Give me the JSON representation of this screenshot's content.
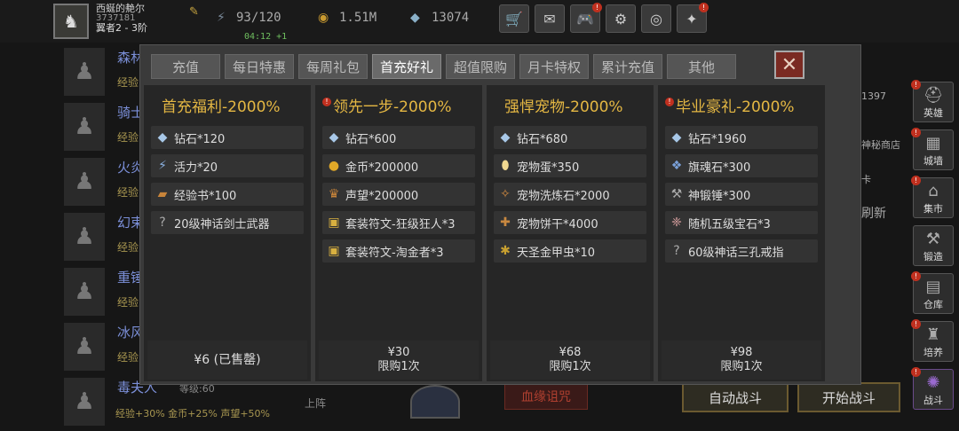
{
  "header": {
    "player_name": "西蜒的艴尔",
    "player_id": "3737181",
    "player_rank": "翼者2 - 3阶",
    "energy": "93/120",
    "timer": "04:12 +1",
    "gold": "1.51M",
    "diamonds": "13074"
  },
  "background": {
    "heroes": [
      {
        "name": "森林",
        "exp": "经验"
      },
      {
        "name": "骑士",
        "exp": "经验"
      },
      {
        "name": "火炎",
        "exp": "经验"
      },
      {
        "name": "幻束",
        "exp": "经验"
      },
      {
        "name": "重锤",
        "exp": "经验"
      },
      {
        "name": "冰风",
        "exp": "经验"
      },
      {
        "name": "毒夫人",
        "exp": "经验",
        "level": "等级:60"
      }
    ],
    "bottom_stats": "经验+30%  金币+25%  声望+50%",
    "up_label": "上阵",
    "curse_label": "血缘诅咒",
    "auto_battle": "自动战斗",
    "start_battle": "开始战斗",
    "right_number": "1397",
    "right_shop": "神秘商店",
    "right_refresh": "刷新",
    "right_card": "卡"
  },
  "sidebar": [
    {
      "label": "英雄",
      "icon": "helmet-icon",
      "alert": true
    },
    {
      "label": "城墙",
      "icon": "wall-icon",
      "alert": true
    },
    {
      "label": "集市",
      "icon": "market-icon",
      "alert": true
    },
    {
      "label": "锻造",
      "icon": "anvil-icon",
      "alert": false
    },
    {
      "label": "仓库",
      "icon": "warehouse-icon",
      "alert": true
    },
    {
      "label": "培养",
      "icon": "train-icon",
      "alert": true
    },
    {
      "label": "战斗",
      "icon": "battle-portal-icon",
      "alert": true
    }
  ],
  "tabs": [
    "充值",
    "每日特惠",
    "每周礼包",
    "首充好礼",
    "超值限购",
    "月卡特权",
    "累计充值",
    "其他"
  ],
  "active_tab": 3,
  "packs": [
    {
      "title": "首充福利-2000%",
      "alert": false,
      "items": [
        {
          "icon": "diamond-icon",
          "text": "钻石*120"
        },
        {
          "icon": "energy-icon",
          "text": "活力*20"
        },
        {
          "icon": "exp-book-icon",
          "text": "经验书*100"
        },
        {
          "icon": "weapon-icon",
          "text": "20级神话剑士武器"
        }
      ],
      "price": "¥6 (已售罄)",
      "limit": ""
    },
    {
      "title": "领先一步-2000%",
      "alert": true,
      "items": [
        {
          "icon": "diamond-icon",
          "text": "钻石*600"
        },
        {
          "icon": "gold-coin-icon",
          "text": "金币*200000"
        },
        {
          "icon": "prestige-icon",
          "text": "声望*200000"
        },
        {
          "icon": "rune-icon",
          "text": "套装符文-狂级狂人*3"
        },
        {
          "icon": "rune-icon",
          "text": "套装符文-淘金者*3"
        }
      ],
      "price": "¥30",
      "limit": "限购1次"
    },
    {
      "title": "强悍宠物-2000%",
      "alert": false,
      "items": [
        {
          "icon": "diamond-icon",
          "text": "钻石*680"
        },
        {
          "icon": "pet-egg-icon",
          "text": "宠物蛋*350"
        },
        {
          "icon": "pet-stone-icon",
          "text": "宠物洗炼石*2000"
        },
        {
          "icon": "pet-biscuit-icon",
          "text": "宠物饼干*4000"
        },
        {
          "icon": "beetle-icon",
          "text": "天圣金甲虫*10"
        }
      ],
      "price": "¥68",
      "limit": "限购1次"
    },
    {
      "title": "毕业豪礼-2000%",
      "alert": true,
      "items": [
        {
          "icon": "diamond-icon",
          "text": "钻石*1960"
        },
        {
          "icon": "soul-stone-icon",
          "text": "旗魂石*300"
        },
        {
          "icon": "hammer-icon",
          "text": "神锻锤*300"
        },
        {
          "icon": "gem-icon",
          "text": "随机五级宝石*3"
        },
        {
          "icon": "ring-icon",
          "text": "60级神话三孔戒指"
        }
      ],
      "price": "¥98",
      "limit": "限购1次"
    }
  ],
  "colors": {
    "title_gold": "#e4b743",
    "alert_red": "#c0301f",
    "dialog_bg": "#3a3a3a",
    "panel_bg": "#262626"
  }
}
